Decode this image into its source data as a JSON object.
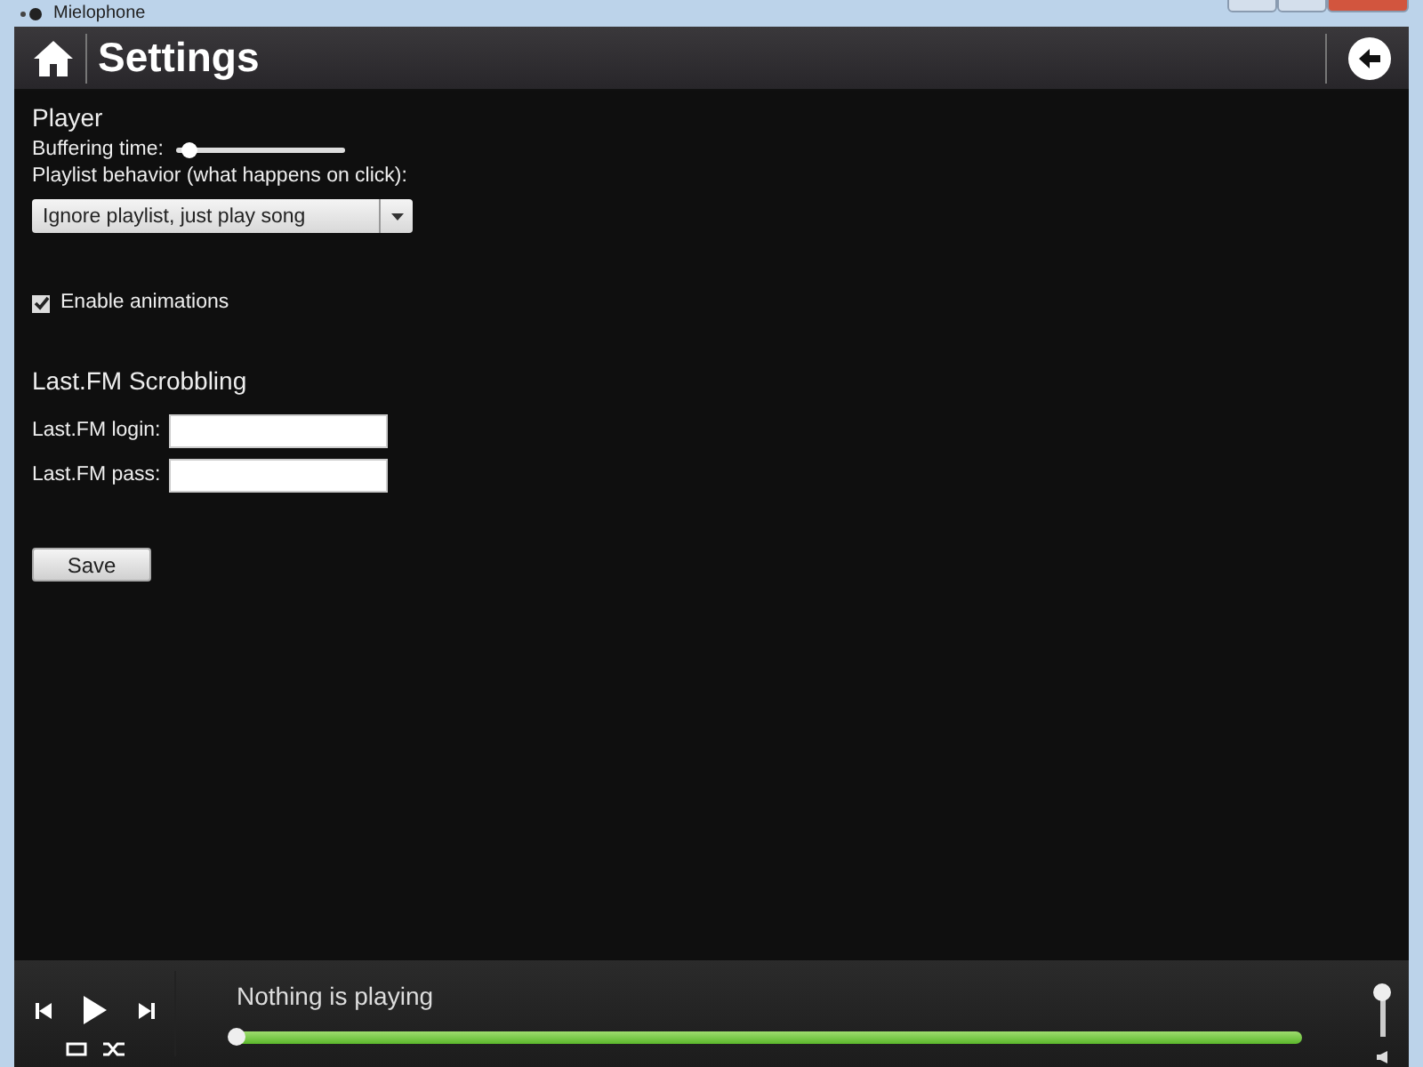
{
  "window": {
    "title": "Mielophone"
  },
  "header": {
    "title": "Settings"
  },
  "player": {
    "heading": "Player",
    "buffering": {
      "label": "Buffering time:",
      "level": 0.08
    },
    "playlist_label": "Playlist behavior (what happens on click):",
    "playlist_select": {
      "value": "Ignore playlist, just play song"
    },
    "animations": {
      "label": "Enable animations",
      "checked": true
    }
  },
  "lastfm": {
    "heading": "Last.FM Scrobbling",
    "fields": [
      {
        "label": "Last.FM login:"
      },
      {
        "label": "Last.FM pass:"
      }
    ]
  },
  "save_button": "Save",
  "footer": {
    "now_playing": "Nothing is playing",
    "seek": {
      "level": 0
    },
    "volume": {
      "level": 1
    }
  }
}
